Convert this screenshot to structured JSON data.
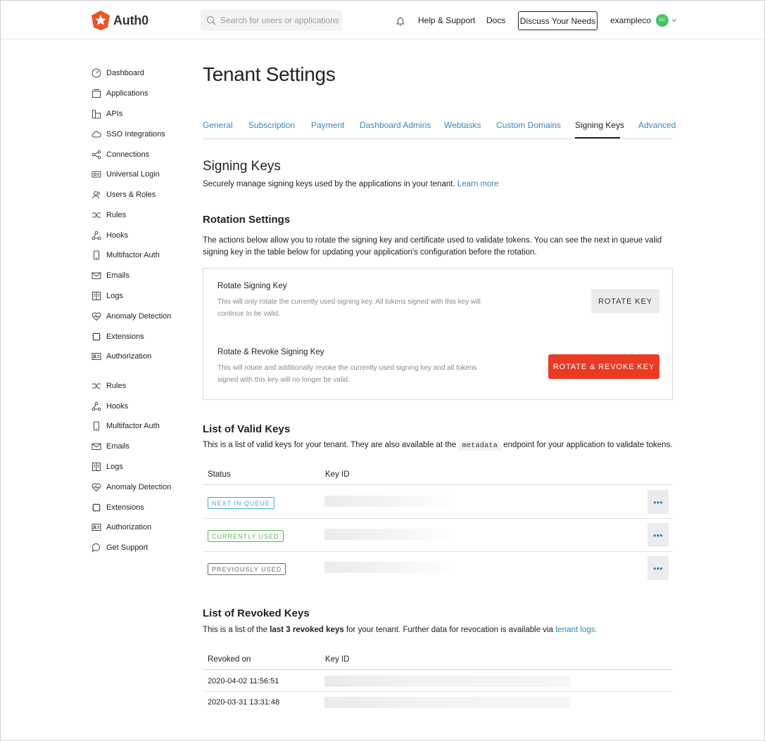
{
  "header": {
    "brand": "Auth0",
    "search_placeholder": "Search for users or applications",
    "help": "Help & Support",
    "docs": "Docs",
    "cta": "Discuss Your Needs",
    "username": "exampleco",
    "avatar_initials": "EC",
    "accent": "#eb5424"
  },
  "sidebar": {
    "items": [
      {
        "label": "Dashboard",
        "icon": "dashboard-icon"
      },
      {
        "label": "Applications",
        "icon": "applications-icon"
      },
      {
        "label": "APIs",
        "icon": "apis-icon"
      },
      {
        "label": "SSO Integrations",
        "icon": "cloud-icon"
      },
      {
        "label": "Connections",
        "icon": "connections-icon"
      },
      {
        "label": "Universal Login",
        "icon": "universal-login-icon"
      },
      {
        "label": "Users & Roles",
        "icon": "users-icon"
      },
      {
        "label": "Rules",
        "icon": "rules-icon"
      },
      {
        "label": "Hooks",
        "icon": "hooks-icon"
      },
      {
        "label": "Multifactor Auth",
        "icon": "phone-icon"
      },
      {
        "label": "Emails",
        "icon": "mail-icon"
      },
      {
        "label": "Logs",
        "icon": "logs-icon"
      },
      {
        "label": "Anomaly Detection",
        "icon": "heart-icon"
      },
      {
        "label": "Extensions",
        "icon": "extensions-icon"
      },
      {
        "label": "Authorization",
        "icon": "authorization-icon"
      },
      {
        "label": "Rules",
        "icon": "rules-icon"
      },
      {
        "label": "Hooks",
        "icon": "hooks-icon"
      },
      {
        "label": "Multifactor Auth",
        "icon": "phone-icon"
      },
      {
        "label": "Emails",
        "icon": "mail-icon"
      },
      {
        "label": "Logs",
        "icon": "logs-icon"
      },
      {
        "label": "Anomaly Detection",
        "icon": "heart-icon"
      },
      {
        "label": "Extensions",
        "icon": "extensions-icon"
      },
      {
        "label": "Authorization",
        "icon": "authorization-icon"
      },
      {
        "label": "Get Support",
        "icon": "chat-icon"
      }
    ]
  },
  "page": {
    "title": "Tenant Settings",
    "tabs": [
      "General",
      "Subscription",
      "Payment",
      "Dashboard Admins",
      "Webtasks",
      "Custom Domains",
      "Signing Keys",
      "Advanced"
    ],
    "active_tab": "Signing Keys"
  },
  "signing": {
    "title": "Signing Keys",
    "desc": "Securely manage signing keys used by the applications in your tenant.",
    "learn_more": "Learn more"
  },
  "rotation": {
    "title": "Rotation Settings",
    "desc": "The actions below allow you to rotate the signing key and certificate used to validate tokens. You can see the next in queue valid signing key in the table below for updating your application's configuration before the rotation.",
    "rotate_title": "Rotate Signing Key",
    "rotate_desc": "This will only rotate the currently used signing key. All tokens signed with this key will continue to be valid.",
    "rotate_btn": "ROTATE KEY",
    "revoke_title": "Rotate & Revoke Signing Key",
    "revoke_desc": "This will rotate and additionally revoke the currently used signing key and all tokens signed with this key will no longer be valid.",
    "revoke_btn": "ROTATE & REVOKE KEY",
    "danger_color": "#eb3a24"
  },
  "valid_keys": {
    "title": "List of Valid Keys",
    "desc_before": "This is a list of valid keys for your tenant. They are also available at the",
    "code": "metadata",
    "desc_after": "endpoint for your application to validate tokens.",
    "col_status": "Status",
    "col_key": "Key ID",
    "rows": [
      {
        "status": "NEXT IN QUEUE",
        "color": "#44a6d9"
      },
      {
        "status": "CURRENTLY USED",
        "color": "#5bb55b"
      },
      {
        "status": "PREVIOUSLY USED",
        "color": "#6b6b72"
      }
    ],
    "more": "•••"
  },
  "revoked_keys": {
    "title": "List of Revoked Keys",
    "desc_before": "This is a list of the",
    "desc_bold": "last 3 revoked keys",
    "desc_mid": "for your tenant. Further data for revocation is available via",
    "desc_link": "tenant logs.",
    "col_revoked": "Revoked on",
    "col_key": "Key ID",
    "rows": [
      {
        "date": "2020-04-02 11:56:51"
      },
      {
        "date": "2020-03-31 13:31:48"
      }
    ]
  }
}
